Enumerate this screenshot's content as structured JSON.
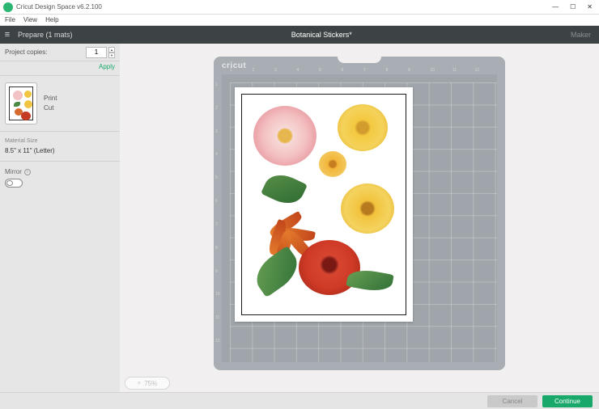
{
  "window": {
    "title": "Cricut Design Space  v6.2.100",
    "menu": [
      "File",
      "View",
      "Help"
    ],
    "controls": {
      "min": "—",
      "max": "☐",
      "close": "✕"
    }
  },
  "header": {
    "prepare": "Prepare (1 mats)",
    "project": "Botanical Stickers*",
    "machine": "Maker"
  },
  "sidebar": {
    "copies_label": "Project copies:",
    "copies_value": "1",
    "apply": "Apply",
    "operation_line1": "Print",
    "operation_line2": "Cut",
    "material_label": "Material Size",
    "material_value": "8.5\" x 11\" (Letter)",
    "mirror_label": "Mirror",
    "mirror_info": "i"
  },
  "mat": {
    "brand": "cricut",
    "ruler": [
      "1",
      "2",
      "3",
      "4",
      "5",
      "6",
      "7",
      "8",
      "9",
      "10",
      "11",
      "12"
    ]
  },
  "zoom": "75%",
  "footer": {
    "cancel": "Cancel",
    "continue": "Continue"
  }
}
